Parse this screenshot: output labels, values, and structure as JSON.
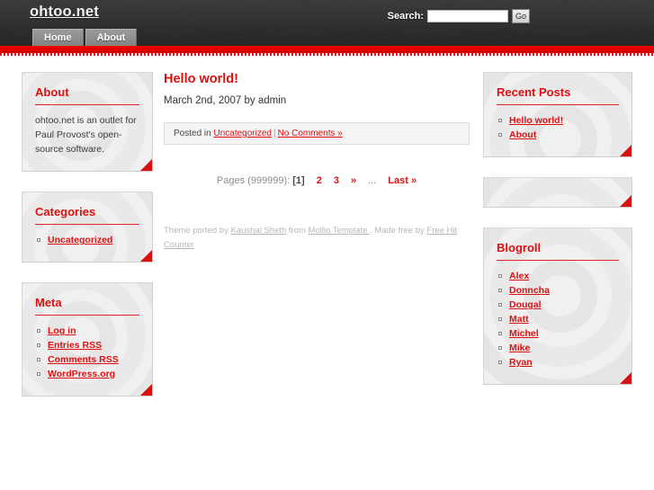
{
  "header": {
    "site_title": "ohtoo.net",
    "search_label": "Search:",
    "search_value": "",
    "search_placeholder": "",
    "search_button": "Go",
    "nav": [
      {
        "label": "Home"
      },
      {
        "label": "About"
      }
    ]
  },
  "sidebar_left": {
    "widgets": [
      {
        "title": "About",
        "type": "text",
        "text": "ohtoo.net is an outlet for Paul Provost's open-source software."
      },
      {
        "title": "Categories",
        "type": "list",
        "items": [
          {
            "label": "Uncategorized"
          }
        ]
      },
      {
        "title": "Meta",
        "type": "list",
        "items": [
          {
            "label": "Log in"
          },
          {
            "label": "Entries RSS"
          },
          {
            "label": "Comments RSS"
          },
          {
            "label": "WordPress.org"
          }
        ]
      }
    ]
  },
  "main": {
    "post": {
      "title": "Hello world!",
      "meta": "March 2nd, 2007 by admin",
      "footer_prefix": "Posted in ",
      "category": "Uncategorized",
      "separator": "|",
      "comments": "No Comments »"
    },
    "pagination": {
      "label": "Pages (999999):",
      "current": "[1]",
      "pages": [
        "2",
        "3"
      ],
      "next": "»",
      "ellipsis": "...",
      "last": "Last »"
    },
    "credits": {
      "part1": "Theme ported by ",
      "link1": "Kaushal Sheth",
      "part2": " from ",
      "link2": "Mollio Template ",
      "part3": ". Made free by ",
      "link3": "Free Hit Counter"
    }
  },
  "sidebar_right": {
    "widgets": [
      {
        "title": "Recent Posts",
        "type": "list",
        "items": [
          {
            "label": "Hello world!"
          },
          {
            "label": "About"
          }
        ]
      },
      {
        "title": "",
        "type": "empty",
        "items": []
      },
      {
        "title": "Blogroll",
        "type": "list",
        "items": [
          {
            "label": "Alex"
          },
          {
            "label": "Donncha"
          },
          {
            "label": "Dougal"
          },
          {
            "label": "Matt"
          },
          {
            "label": "Michel"
          },
          {
            "label": "Mike"
          },
          {
            "label": "Ryan"
          }
        ]
      }
    ]
  },
  "colors": {
    "accent_red": "#e01010",
    "header_dark": "#333333",
    "bar_red": "#d40000",
    "widget_bg": "#f0f0f0"
  }
}
